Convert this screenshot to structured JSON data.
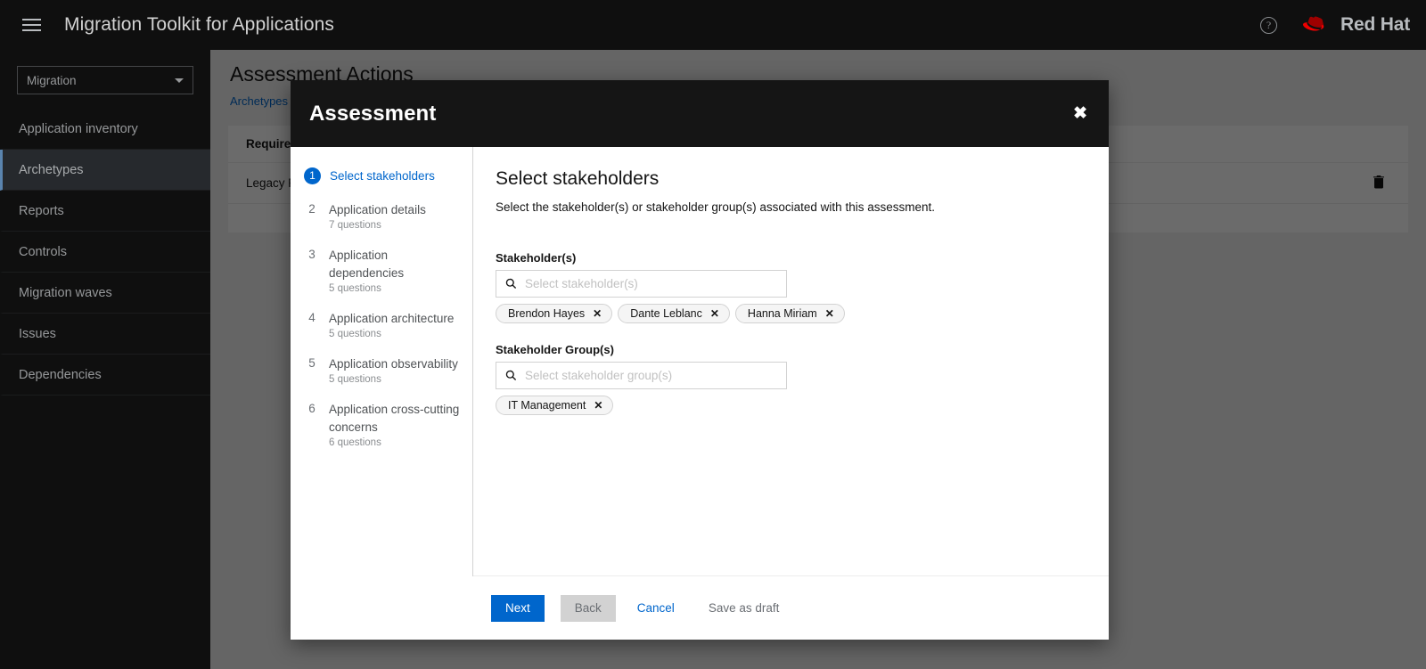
{
  "masthead": {
    "menu_icon": "hamburger-icon",
    "title": "Migration Toolkit for Applications",
    "help_icon": "question-circle-icon",
    "brand": "Red Hat"
  },
  "sidebar": {
    "selector": {
      "value": "Migration",
      "caret_icon": "chevron-down-icon"
    },
    "items": [
      {
        "label": "Application inventory",
        "active": false
      },
      {
        "label": "Archetypes",
        "active": true
      },
      {
        "label": "Reports",
        "active": false
      },
      {
        "label": "Controls",
        "active": false
      },
      {
        "label": "Migration waves",
        "active": false
      },
      {
        "label": "Issues",
        "active": false
      },
      {
        "label": "Dependencies",
        "active": false
      }
    ]
  },
  "page": {
    "title": "Assessment Actions",
    "breadcrumb": {
      "link": "Archetypes",
      "separator": ">"
    },
    "table": {
      "columns": [
        "Required"
      ],
      "rows": [
        {
          "name": "Legacy Pa",
          "action_icon": "trash-icon"
        }
      ]
    }
  },
  "modal": {
    "title": "Assessment",
    "close_icon": "close-icon",
    "wizard_steps": [
      {
        "num": "1",
        "label": "Select stakeholders",
        "sub": "",
        "current": true
      },
      {
        "num": "2",
        "label": "Application details",
        "sub": "7 questions",
        "current": false
      },
      {
        "num": "3",
        "label": "Application dependencies",
        "sub": "5 questions",
        "current": false
      },
      {
        "num": "4",
        "label": "Application architecture",
        "sub": "5 questions",
        "current": false
      },
      {
        "num": "5",
        "label": "Application observability",
        "sub": "5 questions",
        "current": false
      },
      {
        "num": "6",
        "label": "Application cross-cutting concerns",
        "sub": "6 questions",
        "current": false
      }
    ],
    "content": {
      "heading": "Select stakeholders",
      "description": "Select the stakeholder(s) or stakeholder group(s) associated with this assessment.",
      "stakeholders": {
        "label": "Stakeholder(s)",
        "placeholder": "Select stakeholder(s)",
        "search_icon": "search-icon",
        "value": "",
        "chips": [
          "Brendon Hayes",
          "Dante Leblanc",
          "Hanna Miriam"
        ]
      },
      "stakeholder_groups": {
        "label": "Stakeholder Group(s)",
        "placeholder": "Select stakeholder group(s)",
        "search_icon": "search-icon",
        "value": "",
        "chips": [
          "IT Management"
        ]
      }
    },
    "footer": {
      "next": "Next",
      "back": "Back",
      "cancel": "Cancel",
      "save_draft": "Save as draft"
    }
  },
  "colors": {
    "accent_blue": "#06c",
    "masthead_bg": "#0f0f0f",
    "brand_red": "#ee0000"
  }
}
